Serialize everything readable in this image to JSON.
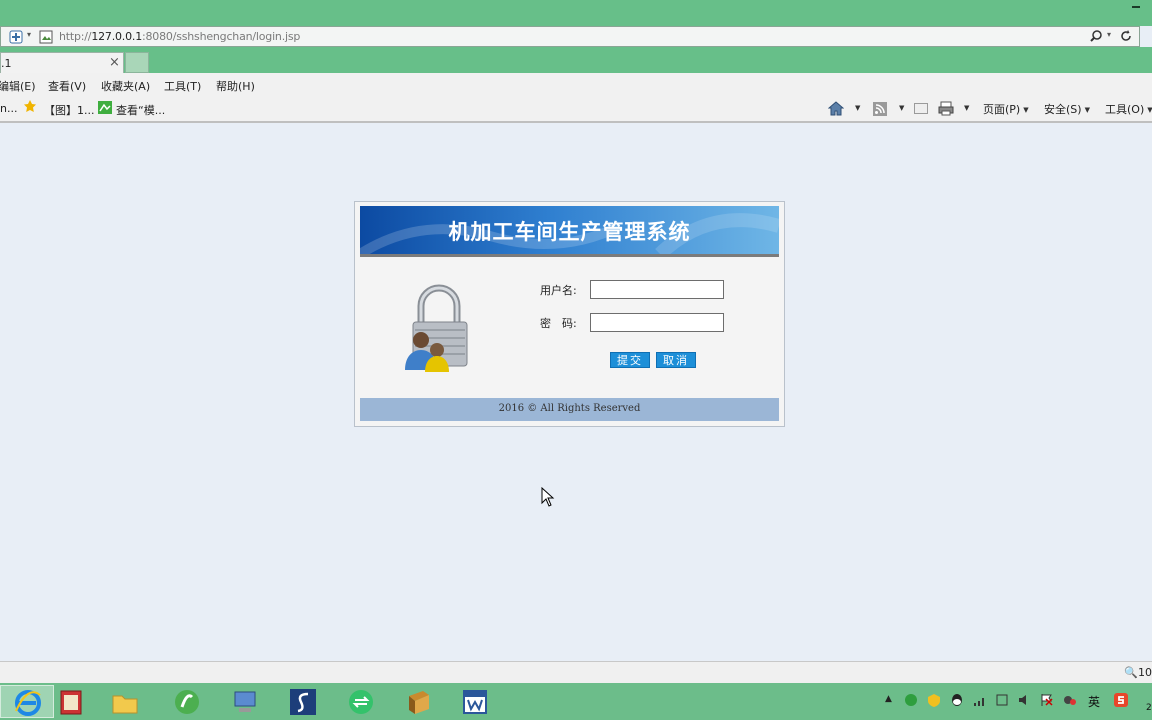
{
  "browser": {
    "url_prefix": "http://",
    "url_host": "127.0.0.1",
    "url_rest": ":8080/sshshengchan/login.jsp",
    "tab_title": ".1",
    "tab_close": "×",
    "menu": [
      "编辑(E)",
      "查看(V)",
      "收藏夹(A)",
      "工具(T)",
      "帮助(H)"
    ],
    "favorites": [
      "n...",
      "【图】1...",
      "查看“模..."
    ],
    "commands": {
      "page": "页面(P)",
      "safety": "安全(S)",
      "tools": "工具(O)"
    },
    "zoom": "10"
  },
  "login": {
    "system_title": "机加工车间生产管理系统",
    "username_label": "用户名:",
    "password_label": "密　码:",
    "username_value": "",
    "password_value": "",
    "submit_label": "提交",
    "cancel_label": "取消",
    "copyright": "2016 © All Rights Reserved"
  },
  "taskbar": {
    "ime": "英",
    "clock_partial": "2"
  },
  "colors": {
    "window_green": "#67bf89",
    "banner_blue": "#0c4aa2",
    "button_blue": "#1d8fd8",
    "footer_blue": "#9bb6d6",
    "page_bg": "#e8eef6"
  }
}
